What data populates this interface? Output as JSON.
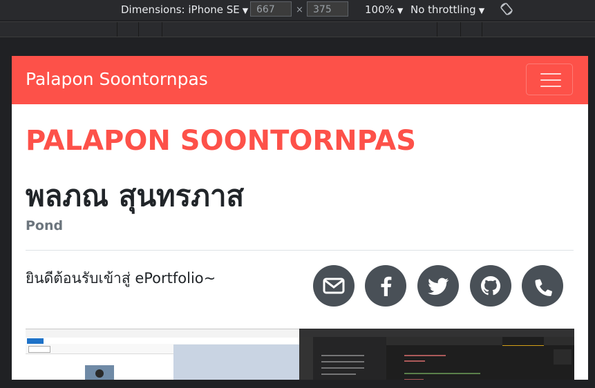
{
  "devtools": {
    "dimensions_label": "Dimensions: iPhone SE",
    "width": "667",
    "height": "375",
    "zoom": "100%",
    "throttling": "No throttling",
    "times": "×",
    "icons": [
      "caret-down-icon",
      "rotate-icon"
    ]
  },
  "site": {
    "brand": "Palapon Soontornpas",
    "heading_en": "PALAPON SOONTORNPAS",
    "heading_th": "พลภณ สุนทรภาส",
    "nickname": "Pond",
    "welcome": "ยินดีต้อนรับเข้าสู่ ePortfolio~",
    "social_icons": [
      "email-icon",
      "facebook-icon",
      "twitter-icon",
      "github-icon",
      "phone-icon"
    ]
  },
  "colors": {
    "brand": "#fd5149",
    "social_bg": "#495057",
    "devtools_bg": "#202124"
  }
}
